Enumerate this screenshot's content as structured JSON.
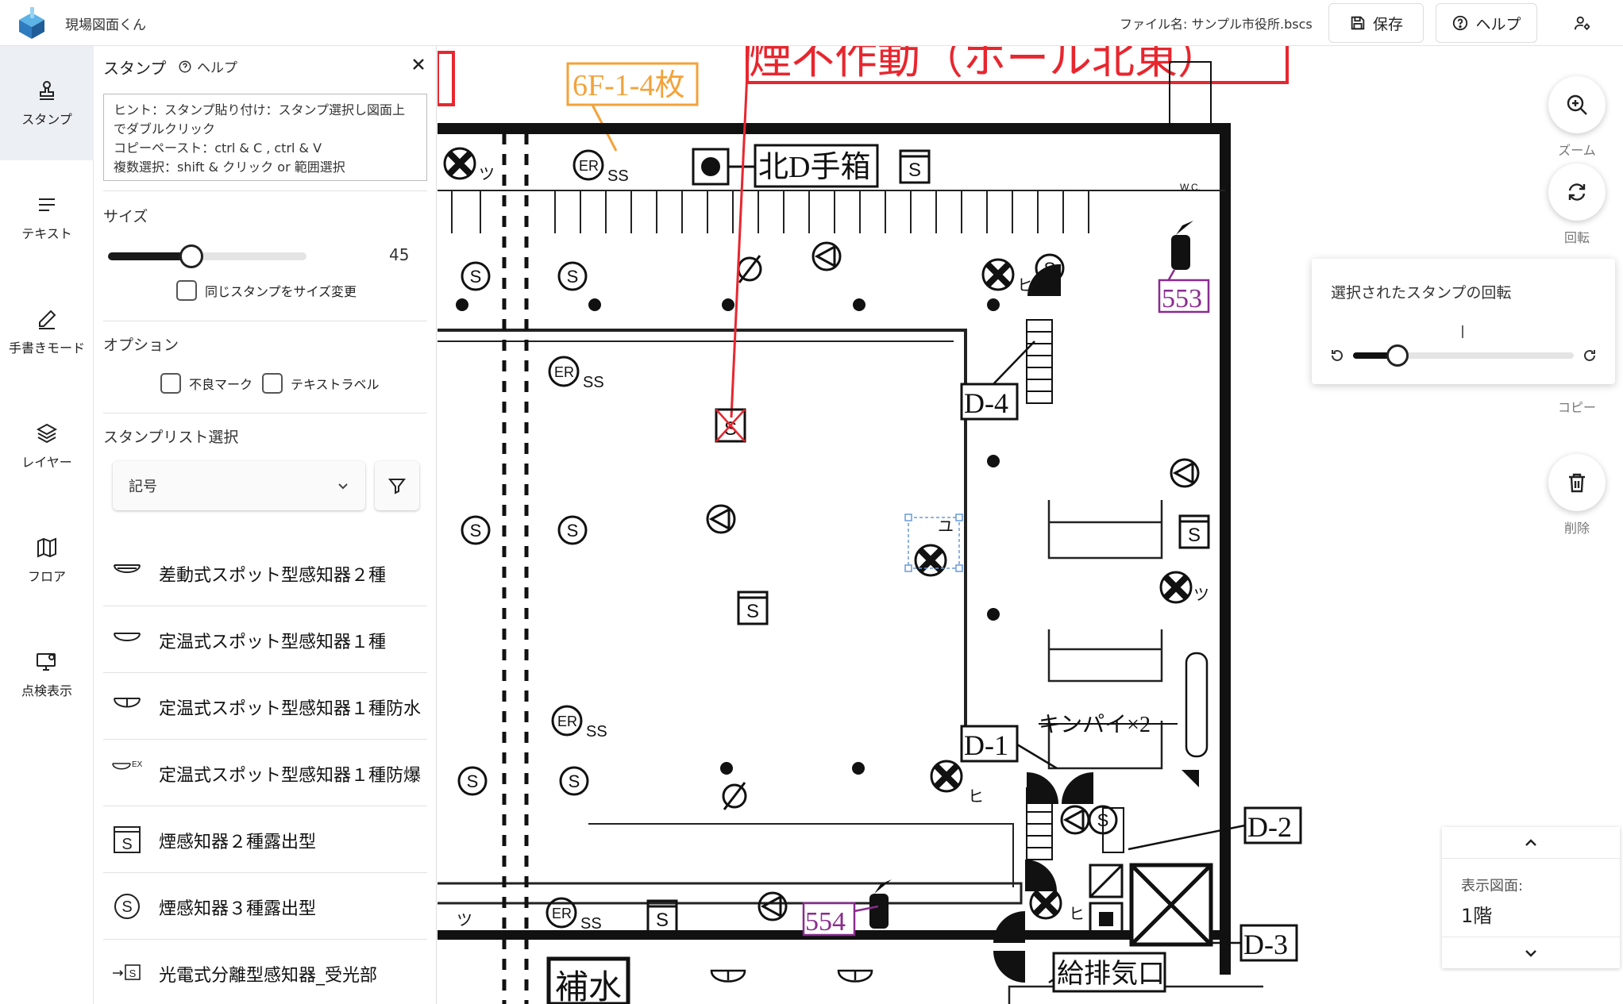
{
  "app": {
    "title": "現場図面くん",
    "file_name": "ファイル名: サンプル市役所.bscs"
  },
  "toolbar": {
    "save_label": "保存",
    "help_label": "ヘルプ"
  },
  "nav": [
    {
      "label": "スタンプ",
      "icon": "stamp-icon"
    },
    {
      "label": "テキスト",
      "icon": "text-lines-icon"
    },
    {
      "label": "手書きモード",
      "icon": "pencil-icon"
    },
    {
      "label": "レイヤー",
      "icon": "layers-icon"
    },
    {
      "label": "フロア",
      "icon": "map-icon"
    },
    {
      "label": "点検表示",
      "icon": "monitor-user-icon"
    }
  ],
  "panel": {
    "title": "スタンプ",
    "help": "ヘルプ",
    "hint": [
      "ヒント：スタンプ貼り付け：スタンプ選択し図面上でダブルクリック",
      "コピーペースト：ctrl & C , ctrl & V",
      "複数選択：shift & クリック or 範囲選択"
    ],
    "size_label": "サイズ",
    "size_value": "45",
    "size_fraction": 0.42,
    "resize_same_label": "同じスタンプをサイズ変更",
    "options_label": "オプション",
    "defect_label": "不良マーク",
    "text_label_label": "テキストラベル",
    "stamp_list_label": "スタンプリスト選択",
    "stamp_list_value": "記号",
    "stamps": [
      {
        "label": "差動式スポット型感知器２種",
        "icon": "diff-spot-detector-icon"
      },
      {
        "label": "定温式スポット型感知器１種",
        "icon": "fixed-temp-detector-icon"
      },
      {
        "label": "定温式スポット型感知器１種防水",
        "icon": "waterproof-detector-icon"
      },
      {
        "label": "定温式スポット型感知器１種防爆",
        "icon": "explosion-proof-detector-icon",
        "badge": "EX"
      },
      {
        "label": "煙感知器２種露出型",
        "icon": "smoke-detector-square-icon",
        "glyph": "S"
      },
      {
        "label": "煙感知器３種露出型",
        "icon": "smoke-detector-circle-icon",
        "glyph": "S"
      },
      {
        "label": "光電式分離型感知器_受光部",
        "icon": "photoelectric-receiver-icon",
        "glyph": "S"
      }
    ]
  },
  "right_tools": [
    {
      "label": "ズーム",
      "icon": "zoom-in-icon"
    },
    {
      "label": "回転",
      "icon": "rotate-icon"
    },
    {
      "label": "コピー",
      "icon": "copy-icon"
    },
    {
      "label": "削除",
      "icon": "trash-icon"
    }
  ],
  "rotation_popup": {
    "title": "選択されたスタンプの回転",
    "fraction": 0.2
  },
  "floor": {
    "label": "表示図面:",
    "value": "1階"
  },
  "drawing": {
    "title_fragment": "煙不作動（ホール北東）",
    "orange_label": "6F-1-4枚",
    "north_box": "北D手箱",
    "tag_553": "553",
    "tag_554": "554",
    "d1": "D-1",
    "d2": "D-2",
    "d3": "D-3",
    "d4": "D-4",
    "kinpai": "キンパイ×2",
    "exhaust": "給排気口",
    "hosui": "補水",
    "er": "ER",
    "ss": "SS",
    "s": "S",
    "tsu": "ツ",
    "hi": "ヒ",
    "yu": "ユ",
    "wc": "W.C.",
    "colors": {
      "red": "#e8262e",
      "orange": "#f3a23a",
      "purple": "#8a2b8f",
      "select": "#6a9ad8"
    }
  }
}
